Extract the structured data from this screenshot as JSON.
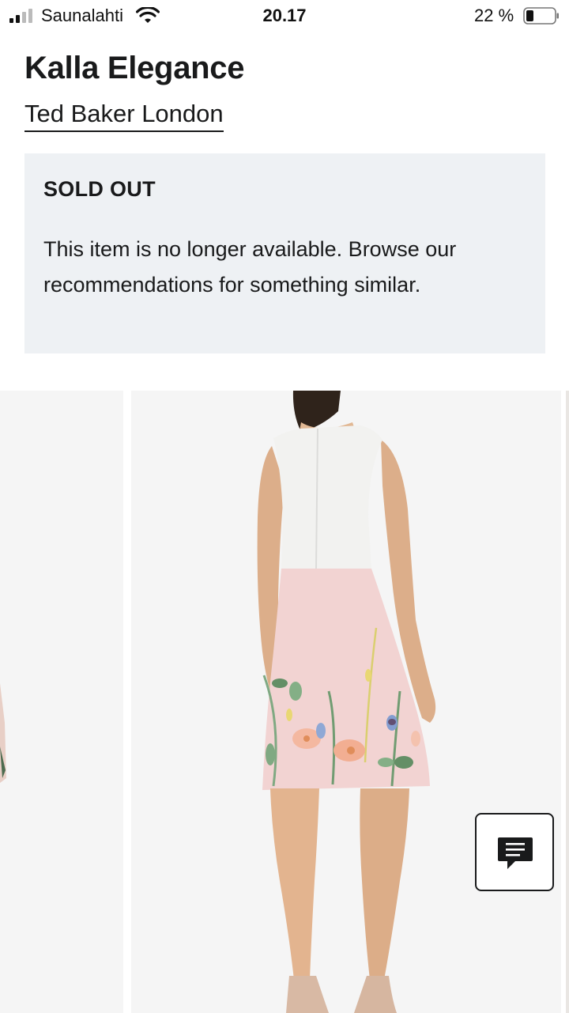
{
  "status_bar": {
    "carrier": "Saunalahti",
    "time": "20.17",
    "battery_percent": "22 %",
    "icons": [
      "signal-icon",
      "wifi-icon",
      "battery-icon"
    ]
  },
  "product": {
    "title": "Kalla Elegance",
    "brand": "Ted Baker London"
  },
  "notice": {
    "heading": "SOLD OUT",
    "body": "This item is no longer available. Browse our recommendations for something similar."
  },
  "carousel": {
    "image_description": "Woman wearing sleeveless dress with white bodice and pink floral skirt, back view"
  },
  "chat": {
    "icon": "chat-icon"
  },
  "colors": {
    "text": "#191a1b",
    "notice_background": "#eef1f4",
    "image_background": "#f5f5f5",
    "skirt_pink": "#f2d3d2"
  }
}
